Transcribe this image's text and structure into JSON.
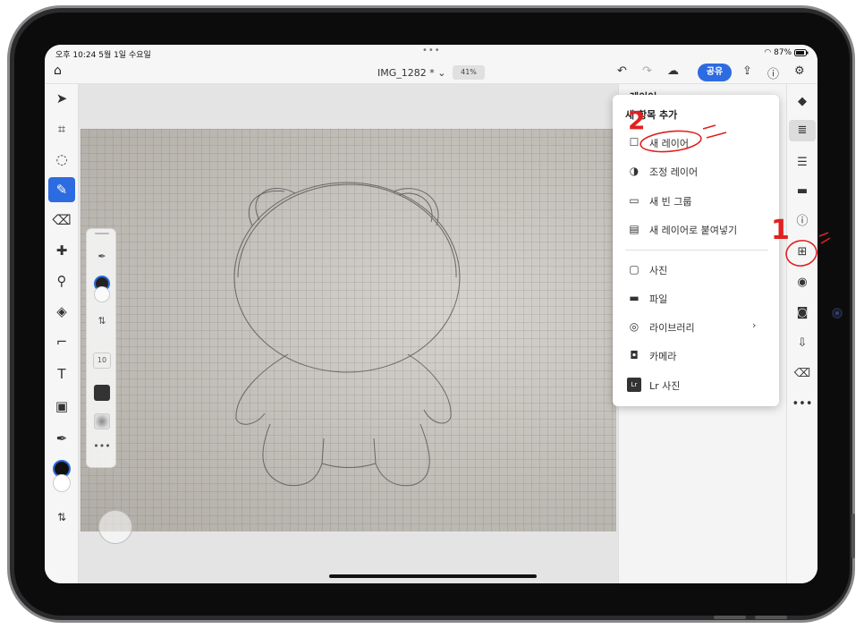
{
  "status_bar": {
    "time_date": "오후 10:24  5월 1일 수요일",
    "battery": "87%"
  },
  "topbar": {
    "document_title": "IMG_1282 * ⌄",
    "zoom": "41%",
    "share_label": "공유"
  },
  "left_tools": {
    "active_tool": "brush",
    "items": [
      "select",
      "transform",
      "lasso",
      "brush",
      "eraser",
      "healing",
      "clone",
      "fill",
      "crop",
      "type",
      "add-image",
      "eyedropper",
      "color",
      "swap"
    ]
  },
  "brush_panel": {
    "size_value": "10"
  },
  "layers_panel": {
    "title": "레이어"
  },
  "add_menu": {
    "header": "새 항목 추가",
    "items": [
      {
        "label": "새 레이어",
        "icon": "square-outline-icon"
      },
      {
        "label": "조정 레이어",
        "icon": "half-circle-icon"
      },
      {
        "label": "새 빈 그룹",
        "icon": "folder-open-icon"
      },
      {
        "label": "새 레이어로 붙여넣기",
        "icon": "clipboard-icon"
      },
      {
        "label": "사진",
        "icon": "photo-icon"
      },
      {
        "label": "파일",
        "icon": "folder-icon"
      },
      {
        "label": "라이브러리",
        "icon": "library-icon",
        "has_submenu": true
      },
      {
        "label": "카메라",
        "icon": "camera-icon"
      },
      {
        "label": "Lr 사진",
        "icon": "lightroom-icon"
      }
    ]
  },
  "annotations": {
    "step1": "1",
    "step2": "2"
  },
  "colors": {
    "accent": "#2d6be0",
    "annotation": "#e02020"
  }
}
